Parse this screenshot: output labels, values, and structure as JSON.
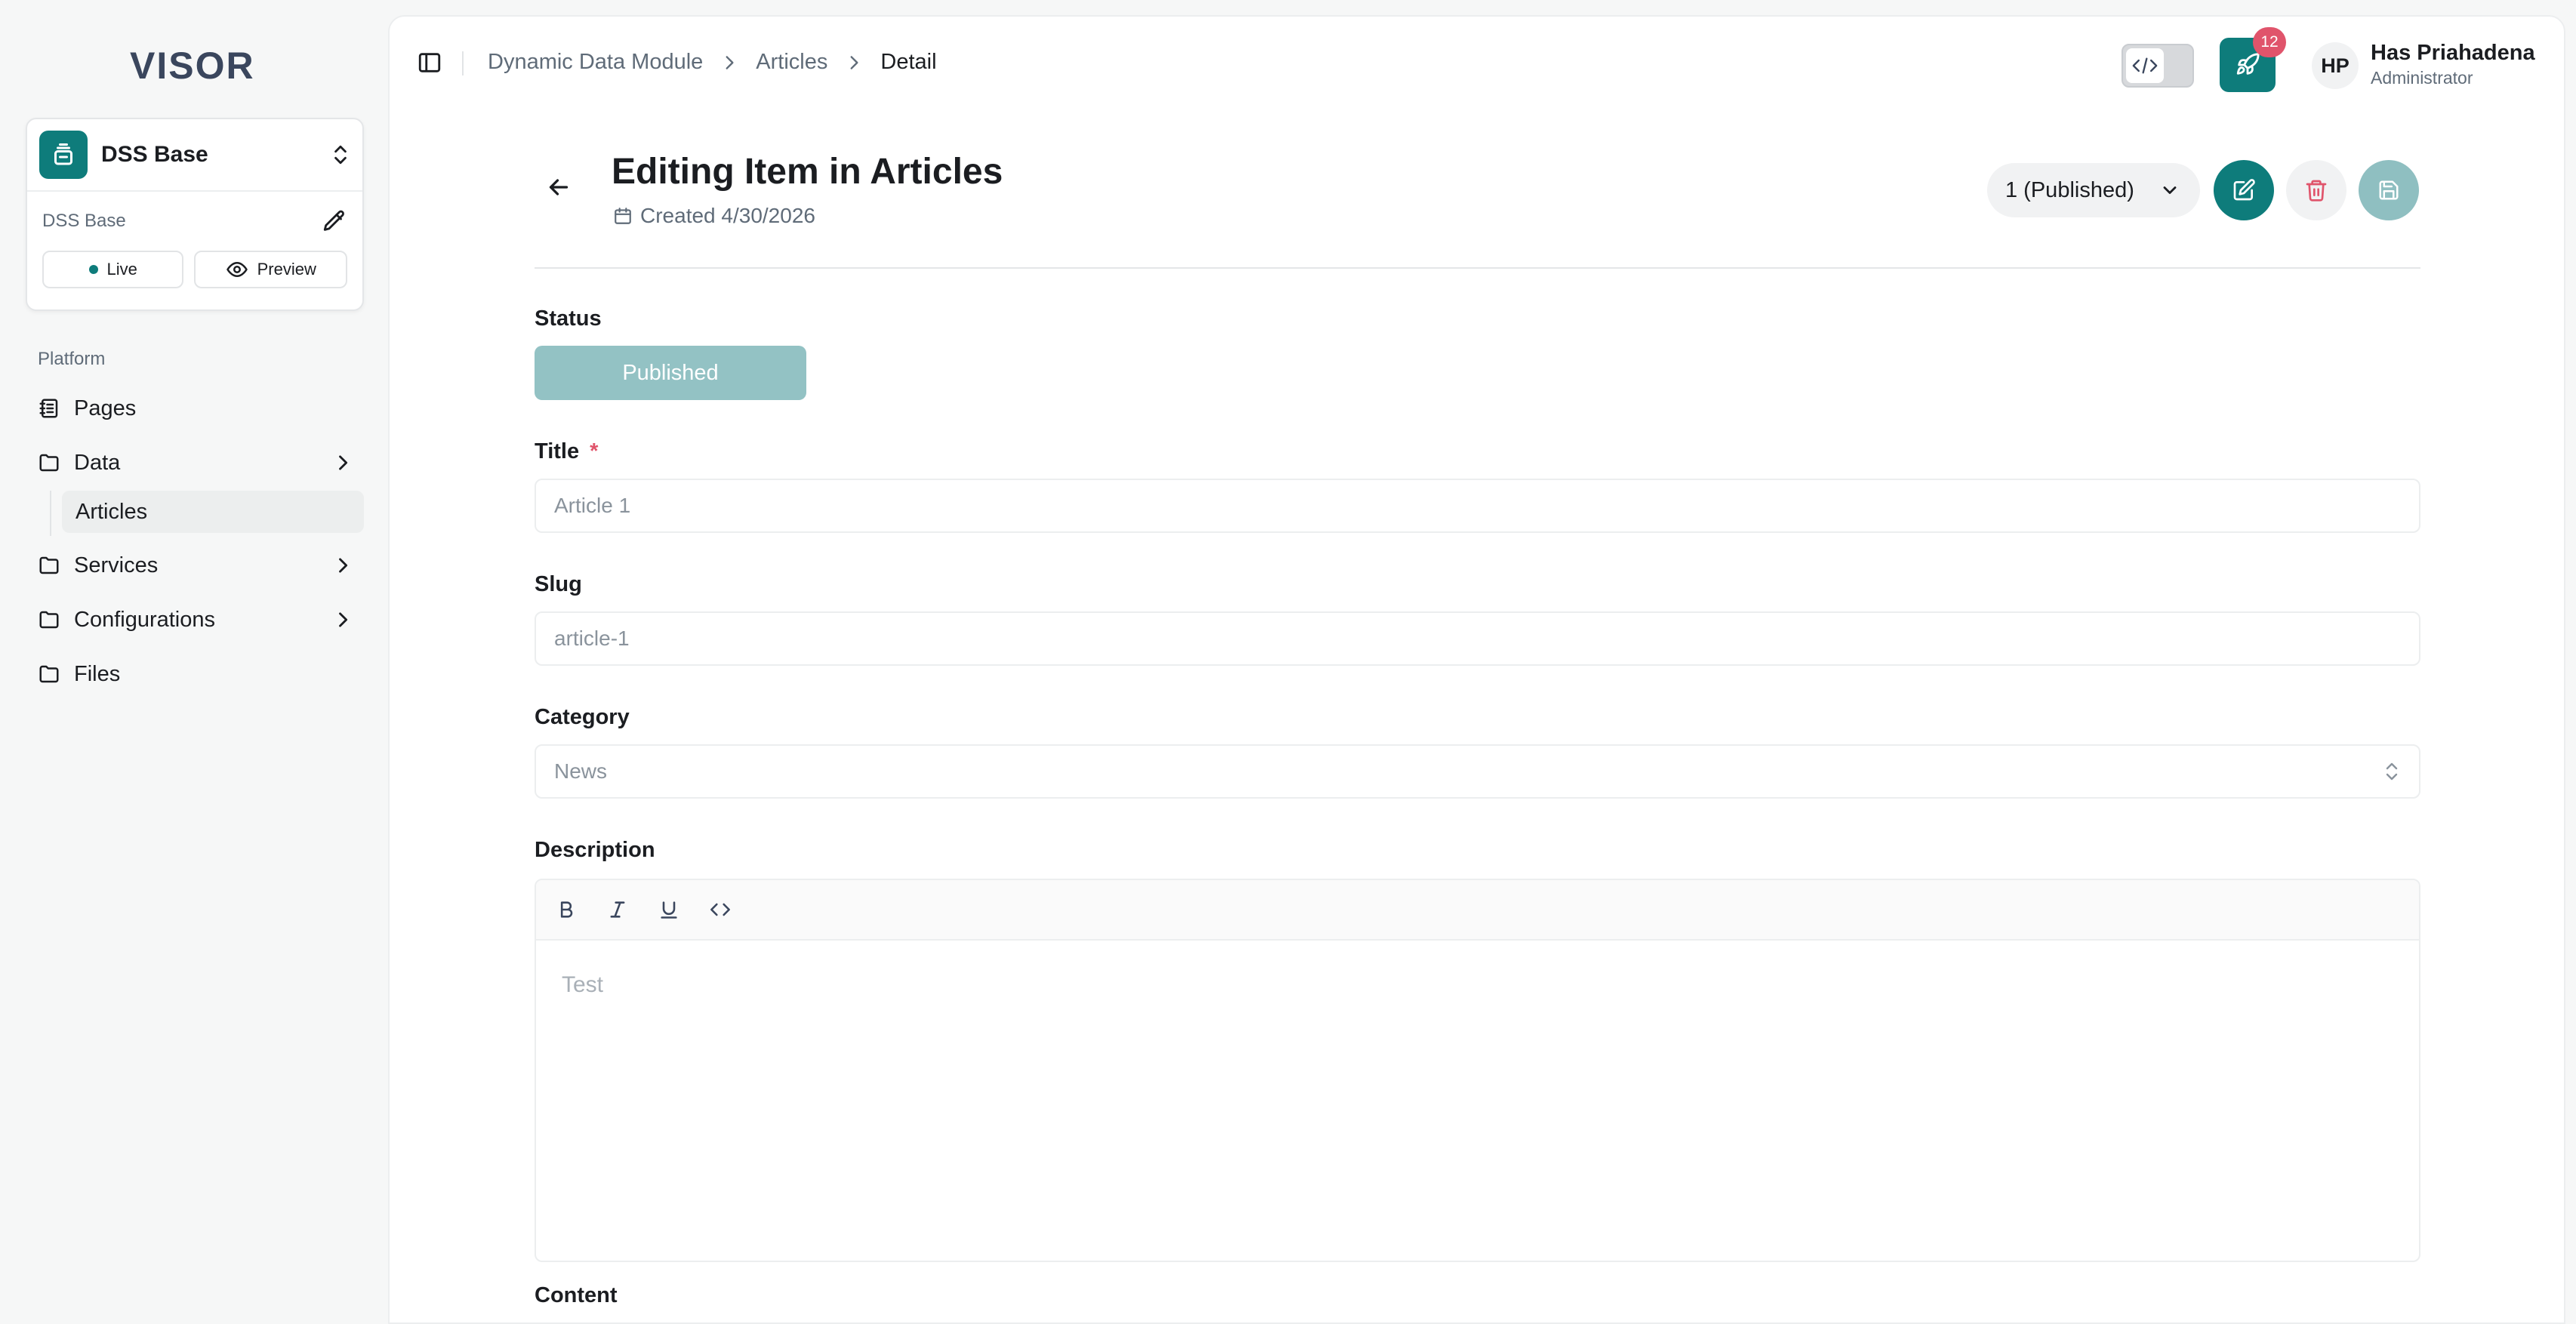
{
  "sidebar": {
    "logo": "VISOR",
    "project": {
      "name": "DSS Base",
      "sub_name": "DSS Base",
      "live_label": "Live",
      "preview_label": "Preview"
    },
    "section_label": "Platform",
    "items": [
      {
        "label": "Pages",
        "icon": "notebook-icon"
      },
      {
        "label": "Data",
        "icon": "folder-icon",
        "expandable": true
      },
      {
        "label": "Services",
        "icon": "folder-icon",
        "expandable": true
      },
      {
        "label": "Configurations",
        "icon": "folder-icon",
        "expandable": true
      },
      {
        "label": "Files",
        "icon": "folder-icon"
      }
    ],
    "data_children": [
      {
        "label": "Articles",
        "active": true
      }
    ]
  },
  "header": {
    "breadcrumb": [
      "Dynamic Data Module",
      "Articles",
      "Detail"
    ],
    "notification_count": "12",
    "user": {
      "initials": "HP",
      "name": "Has Priahadena",
      "role": "Administrator"
    }
  },
  "page": {
    "title": "Editing Item in Articles",
    "created": "Created 4/30/2026",
    "version": "1 (Published)"
  },
  "form": {
    "status_label": "Status",
    "status_value": "Published",
    "title_label": "Title",
    "title_required": "*",
    "title_value": "Article 1",
    "slug_label": "Slug",
    "slug_value": "article-1",
    "category_label": "Category",
    "category_value": "News",
    "description_label": "Description",
    "description_value": "Test",
    "content_label": "Content"
  },
  "colors": {
    "accent": "#0e7c7b",
    "danger": "#e0546b",
    "save_disabled": "#8fbfc1"
  }
}
